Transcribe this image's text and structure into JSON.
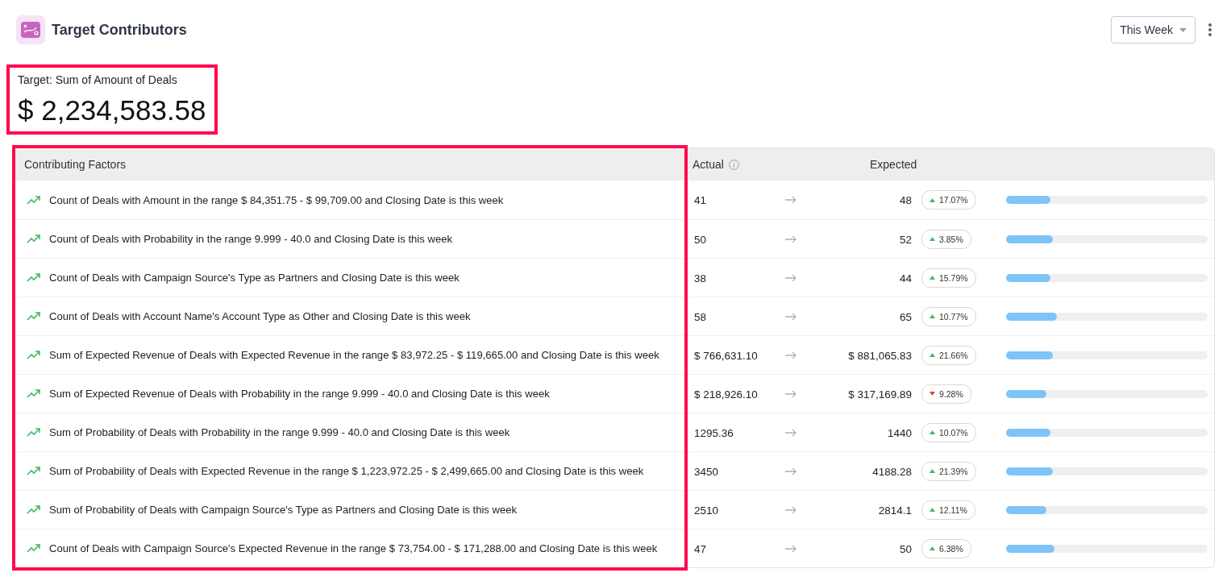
{
  "header": {
    "title": "Target Contributors",
    "period": "This Week"
  },
  "target": {
    "label": "Target: Sum of Amount of Deals",
    "value": "$ 2,234,583.58",
    "highlighted": true
  },
  "table": {
    "columns": {
      "factor": "Contributing Factors",
      "actual": "Actual",
      "expected": "Expected"
    },
    "factor_column_highlighted": true,
    "rows": [
      {
        "factor": "Count of Deals with Amount in the range $ 84,351.75 - $ 99,709.00 and Closing Date is this week",
        "actual": "41",
        "expected": "48",
        "change": "17.07%",
        "increase": true,
        "level": 0.22
      },
      {
        "factor": "Count of Deals with Probability in the range 9.999 - 40.0 and Closing Date is this week",
        "actual": "50",
        "expected": "52",
        "change": "3.85%",
        "increase": true,
        "level": 0.23
      },
      {
        "factor": "Count of Deals with Campaign Source's Type as Partners and Closing Date is this week",
        "actual": "38",
        "expected": "44",
        "change": "15.79%",
        "increase": true,
        "level": 0.22
      },
      {
        "factor": "Count of Deals with Account Name's Account Type as Other and Closing Date is this week",
        "actual": "58",
        "expected": "65",
        "change": "10.77%",
        "increase": true,
        "level": 0.25
      },
      {
        "factor": "Sum of Expected Revenue of Deals with Expected Revenue in the range $ 83,972.25 - $ 119,665.00 and Closing Date is this week",
        "actual": "$ 766,631.10",
        "expected": "$ 881,065.83",
        "change": "21.66%",
        "increase": true,
        "level": 0.23
      },
      {
        "factor": "Sum of Expected Revenue of Deals with Probability in the range 9.999 - 40.0 and Closing Date is this week",
        "actual": "$ 218,926.10",
        "expected": "$ 317,169.89",
        "change": "9.28%",
        "increase": false,
        "level": 0.2
      },
      {
        "factor": "Sum of Probability of Deals with Probability in the range 9.999 - 40.0 and Closing Date is this week",
        "actual": "1295.36",
        "expected": "1440",
        "change": "10.07%",
        "increase": true,
        "level": 0.22
      },
      {
        "factor": "Sum of Probability of Deals with Expected Revenue in the range $ 1,223,972.25 - $ 2,499,665.00 and Closing Date is this week",
        "actual": "3450",
        "expected": "4188.28",
        "change": "21.39%",
        "increase": true,
        "level": 0.23
      },
      {
        "factor": "Sum of Probability of Deals with Campaign Source's Type as Partners and Closing Date is this week",
        "actual": "2510",
        "expected": "2814.1",
        "change": "12.11%",
        "increase": true,
        "level": 0.2
      },
      {
        "factor": "Count of Deals with Campaign Source's Expected Revenue in the range $ 73,754.00 - $ 171,288.00 and Closing Date is this week",
        "actual": "47",
        "expected": "50",
        "change": "6.38%",
        "increase": true,
        "level": 0.24
      }
    ]
  }
}
